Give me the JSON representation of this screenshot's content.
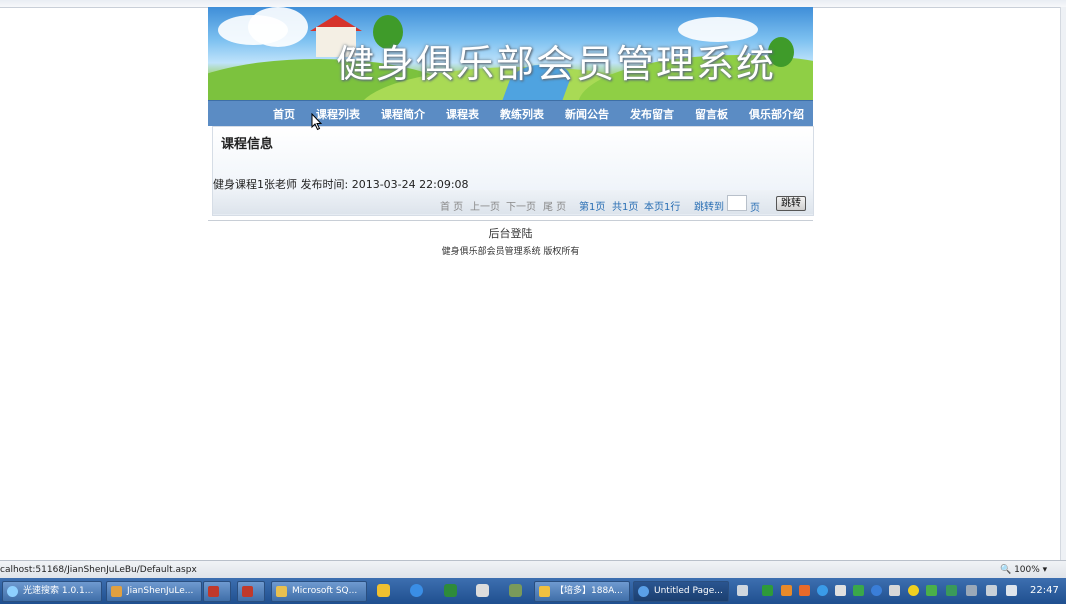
{
  "site": {
    "title": "健身俱乐部会员管理系统"
  },
  "nav": {
    "items": [
      "首页",
      "课程列表",
      "课程简介",
      "课程表",
      "教练列表",
      "新闻公告",
      "发布留言",
      "留言板",
      "俱乐部介绍"
    ]
  },
  "content": {
    "section_title": "课程信息",
    "course_line": "健身课程1张老师  发布时间: 2013-03-24 22:09:08"
  },
  "pager": {
    "first": "首 页",
    "prev": "上一页",
    "next": "下一页",
    "last": "尾 页",
    "page_num": "第1页",
    "total": "共1页",
    "per_page": "本页1行",
    "goto_label": "跳转到",
    "page_unit": "页",
    "goto_button": "跳转"
  },
  "footer": {
    "admin_login": "后台登陆",
    "copyright": "健身俱乐部会员管理系统  版权所有"
  },
  "statusbar": {
    "url": "calhost:51168/JianShenJuLeBu/Default.aspx",
    "zoom": "100%"
  },
  "taskbar": {
    "items": [
      "光速搜索 1.0.1...",
      "JianShenJuLe...",
      "",
      "",
      "Microsoft SQ...",
      "",
      "",
      "",
      "",
      "【培多】188A...",
      "Untitled Page..."
    ],
    "clock": "22:47"
  }
}
